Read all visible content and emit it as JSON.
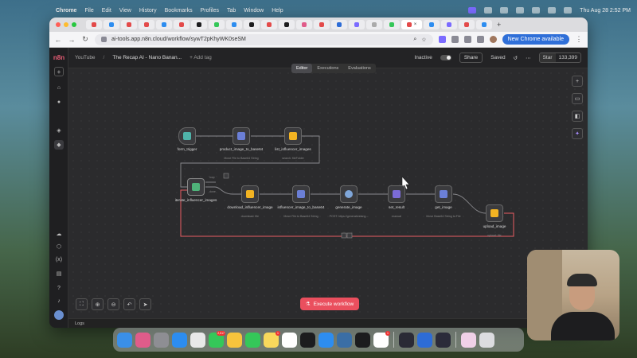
{
  "menubar": {
    "app": "Chrome",
    "items": [
      "File",
      "Edit",
      "View",
      "History",
      "Bookmarks",
      "Profiles",
      "Tab",
      "Window",
      "Help"
    ],
    "clock": "Thu Aug 28  2:52 PM"
  },
  "browser": {
    "url": "ai-tools.app.n8n.cloud/workflow/sywT2pKhyWK0seSM",
    "new_chrome_label": "New Chrome available"
  },
  "n8n": {
    "breadcrumb": "YouTube",
    "workflow_title": "The Recap AI - Nano Banan...",
    "add_tag": "+ Add tag",
    "status": "Inactive",
    "share": "Share",
    "saved": "Saved",
    "github_star": "Star",
    "github_count": "133,399",
    "tabs": [
      "Editor",
      "Executions",
      "Evaluations"
    ],
    "execute_label": "Execute workflow",
    "logs_label": "Logs",
    "nodes": [
      {
        "label": "form_trigger",
        "sub": "",
        "icon_color": "#4fb3a9"
      },
      {
        "label": "product_image_to_base64",
        "sub": "Move File to Base64 String",
        "icon_color": "#6b7fd6"
      },
      {
        "label": "list_influencer_images",
        "sub": "search: fileFolder",
        "icon_color": "#f2b322"
      },
      {
        "label": "iterate_influencer_images",
        "sub": "",
        "icon_color": "#4fb37a"
      },
      {
        "label": "download_influencer_image",
        "sub": "download: file",
        "icon_color": "#f2b322"
      },
      {
        "label": "influencer_image_to_base64",
        "sub": "Move File to Base64 String",
        "icon_color": "#6b7fd6"
      },
      {
        "label": "generate_image",
        "sub": "POST: https://generativelang...",
        "icon_color": "#7fa6d9"
      },
      {
        "label": "set_result",
        "sub": "manual",
        "icon_color": "#7b6bd6"
      },
      {
        "label": "get_image",
        "sub": "Move Base64 String to File",
        "icon_color": "#6b7fd6"
      },
      {
        "label": "upload_image",
        "sub": "upload: file",
        "icon_color": "#f2b322"
      }
    ],
    "loop_labels": [
      "loop",
      "done"
    ]
  },
  "dock": {
    "apps": [
      {
        "name": "finder",
        "color": "#3a8fe8"
      },
      {
        "name": "launchpad",
        "color": "#e05c8a"
      },
      {
        "name": "settings",
        "color": "#8e8e93"
      },
      {
        "name": "safari",
        "color": "#2d8df0"
      },
      {
        "name": "chrome",
        "color": "#e8e8e8"
      },
      {
        "name": "messages",
        "color": "#35c759"
      },
      {
        "name": "photos",
        "color": "#f7c43c"
      },
      {
        "name": "facetime",
        "color": "#35c759"
      },
      {
        "name": "notes",
        "color": "#f8d85c"
      },
      {
        "name": "freeform",
        "color": "#ffffff"
      },
      {
        "name": "tv",
        "color": "#1c1c1e"
      },
      {
        "name": "app-store",
        "color": "#2d8df0"
      },
      {
        "name": "quicktime",
        "color": "#3a6ea5"
      },
      {
        "name": "capcut",
        "color": "#1c1c1e"
      },
      {
        "name": "slack",
        "color": "#ffffff"
      },
      {
        "name": "audio",
        "color": "#2a2a35"
      },
      {
        "name": "onepassword",
        "color": "#2d6cd6"
      },
      {
        "name": "obs",
        "color": "#2b2b3a"
      },
      {
        "name": "downloads",
        "color": "#f0d0e8"
      },
      {
        "name": "trash",
        "color": "#dcdce0"
      }
    ],
    "badges": {
      "messages": "2,517",
      "notes": "1",
      "slack": "1"
    }
  }
}
